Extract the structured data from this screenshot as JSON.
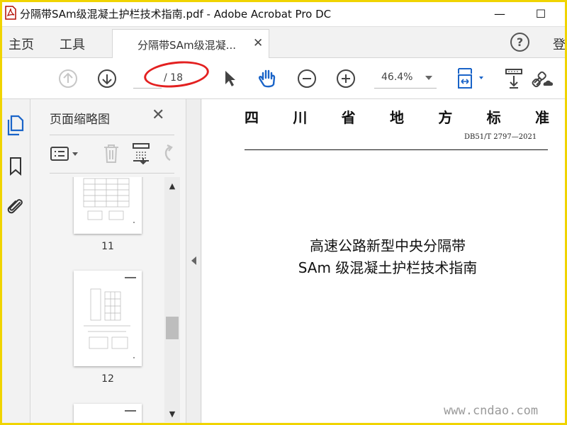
{
  "window": {
    "title": "分隔带SAm级混凝土护栏技术指南.pdf - Adobe Acrobat Pro DC",
    "minimize_label": "—",
    "maximize_label": "☐"
  },
  "menubar": {
    "home": "主页",
    "tools": "工具",
    "tab_label": "分隔带SAm级混凝...",
    "tab_close": "✕",
    "help": "?",
    "signin": "登"
  },
  "toolbar": {
    "page_current": "",
    "page_total": "/ 18",
    "zoom": "46.4%"
  },
  "thumbnail_panel": {
    "title": "页面缩略图",
    "close": "✕",
    "thumbnails": [
      {
        "label": "11"
      },
      {
        "label": "12"
      }
    ]
  },
  "document": {
    "header_chars": [
      "四",
      "川",
      "省",
      "地",
      "方",
      "标",
      "准"
    ],
    "standard_code": "DB51/T 2797—2021",
    "title_line1": "高速公路新型中央分隔带",
    "title_line2": "SAm 级混凝土护栏技术指南"
  },
  "watermark": "www.cndao.com",
  "colors": {
    "accent_blue": "#1a64c8",
    "annotation_red": "#e32020",
    "frame_yellow": "#f0d400"
  }
}
